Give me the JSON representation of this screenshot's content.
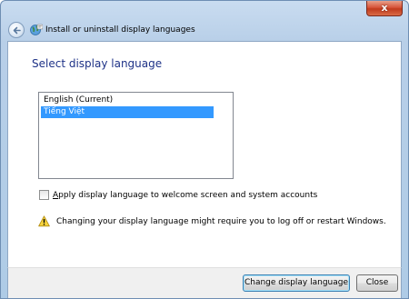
{
  "window": {
    "close_glyph": "x",
    "accent_color": "#1e3287",
    "selection_color": "#3399ff"
  },
  "navbar": {
    "back_icon": "back-arrow-icon",
    "app_icon": "globe-language-icon",
    "title": "Install or uninstall display languages"
  },
  "main": {
    "heading": "Select display language",
    "languages": [
      {
        "label": "English (Current)",
        "selected": false
      },
      {
        "label": "Tiếng Việt",
        "selected": true
      }
    ],
    "checkbox": {
      "label": "Apply display language to welcome screen and system accounts",
      "checked": false
    },
    "warning": {
      "icon": "warning-icon",
      "text": "Changing your display language might require you to log off or restart Windows."
    }
  },
  "footer": {
    "change_label": "Change display language",
    "close_label": "Close"
  }
}
